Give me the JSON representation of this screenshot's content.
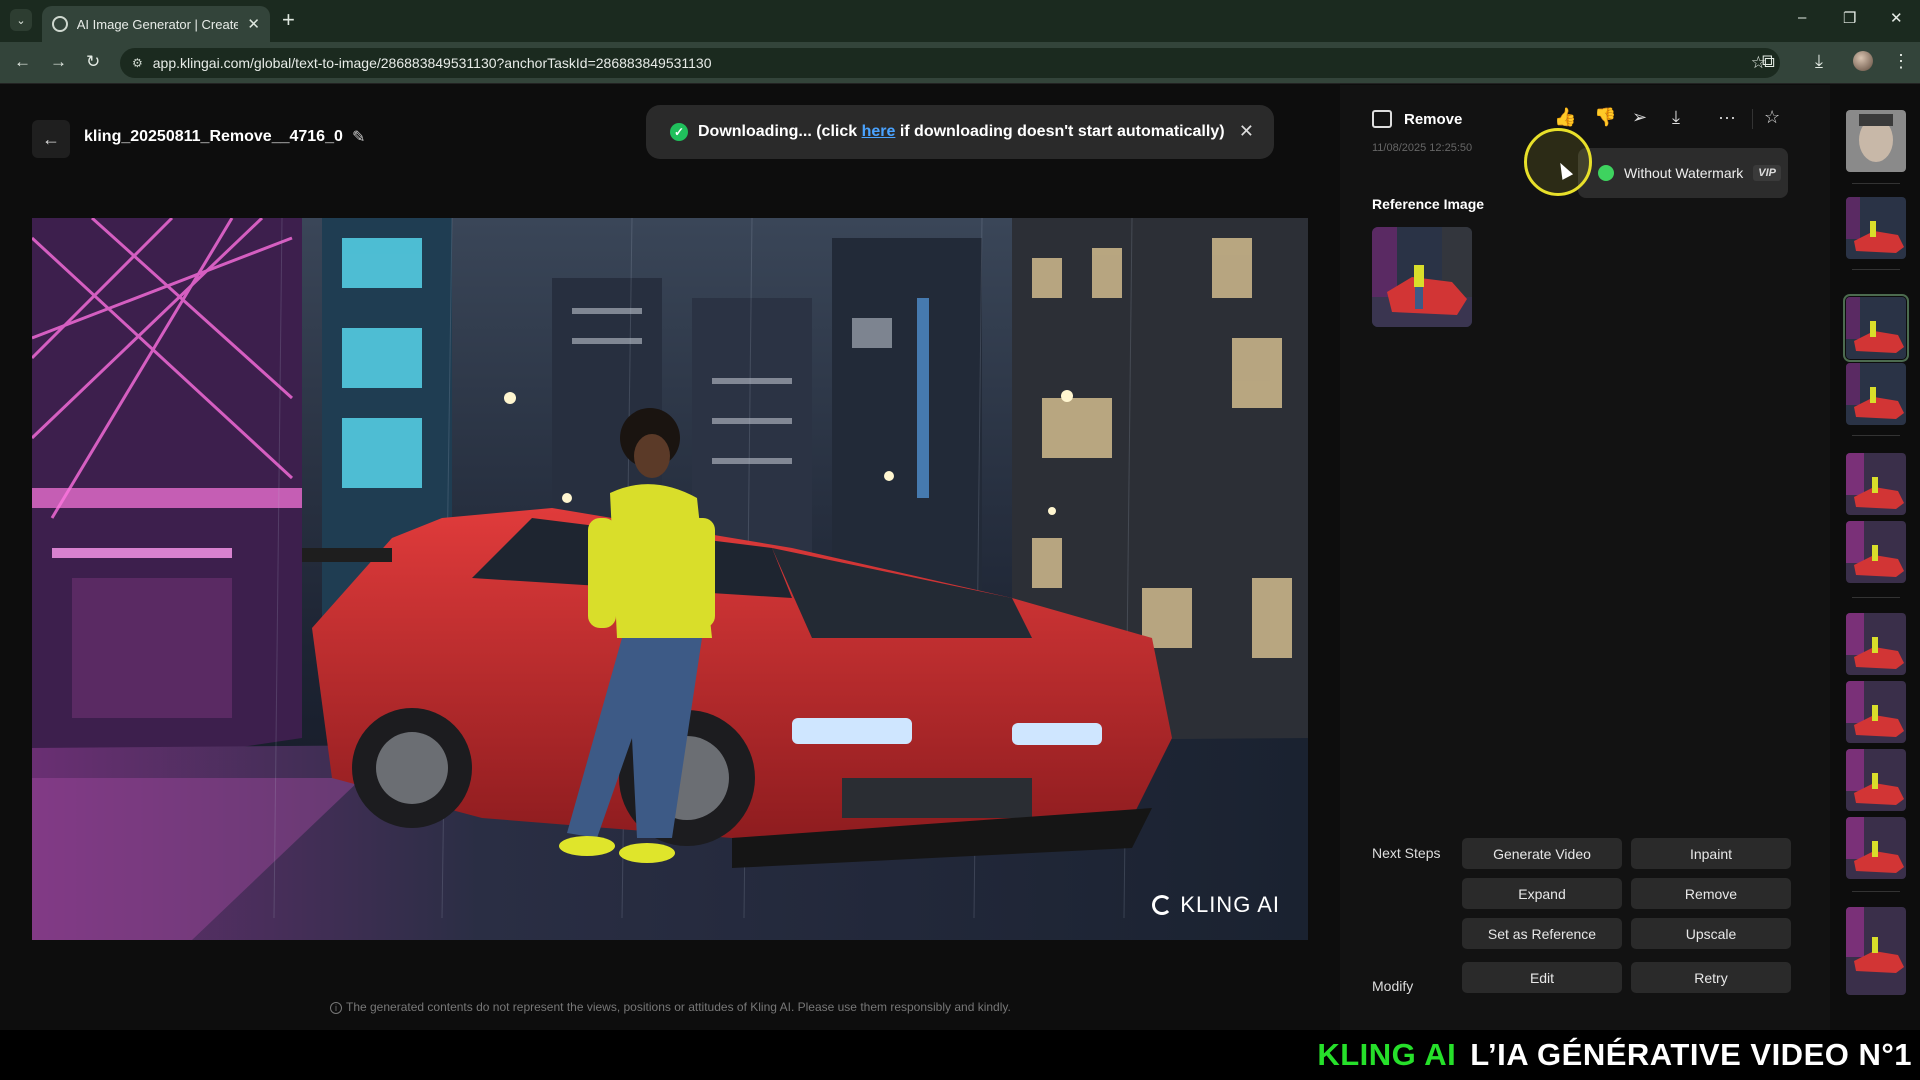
{
  "browser": {
    "tab_title": "AI Image Generator | Create HD",
    "url": "app.klingai.com/global/text-to-image/286883849531130?anchorTaskId=286883849531130",
    "icons": {
      "tab_list": "chevron-down-icon",
      "tab_close": "close-icon",
      "new_tab": "plus-icon",
      "back": "arrow-left-icon",
      "forward": "arrow-right-icon",
      "reload": "reload-icon",
      "bookmark": "star-icon",
      "extensions": "puzzle-icon",
      "download": "download-icon",
      "menu": "kebab-icon"
    },
    "glyphs": {
      "tab_list": "⌄",
      "tab_close": "✕",
      "new_tab": "+",
      "back": "←",
      "forward": "→",
      "reload": "↻",
      "site_info": "⚙",
      "bookmark": "☆",
      "extensions": "⧉",
      "download": "⤓",
      "menu": "⋮",
      "minimize": "–",
      "restore": "❐",
      "close": "✕"
    }
  },
  "header": {
    "title": "kling_20250811_Remove__4716_0",
    "back_glyph": "←",
    "edit_glyph": "✎"
  },
  "toast": {
    "check_glyph": "✓",
    "prefix": "Downloading... (click ",
    "link": "here",
    "suffix": " if downloading doesn't start automatically)",
    "close_glyph": "✕"
  },
  "image": {
    "watermark": "KLING AI"
  },
  "disclaimer": {
    "info_glyph": "i",
    "text": "The generated contents do not represent the views, positions or attitudes of Kling AI. Please use them responsibly and kindly."
  },
  "panel": {
    "title": "Remove",
    "date": "11/08/2025 12:25:50",
    "actions": {
      "like": "👍",
      "dislike": "👎",
      "share": "➢",
      "download": "⤓",
      "more": "···",
      "favorite": "☆"
    },
    "reference_label": "Reference Image",
    "watermark_option": {
      "label": "Without Watermark",
      "badge": "VIP"
    },
    "next_steps_label": "Next Steps",
    "modify_label": "Modify",
    "buttons": {
      "generate_video": "Generate Video",
      "inpaint": "Inpaint",
      "expand": "Expand",
      "remove": "Remove",
      "set_as_reference": "Set as Reference",
      "upscale": "Upscale",
      "edit": "Edit",
      "retry": "Retry"
    }
  },
  "banner": {
    "brand": "KLING AI",
    "text": "L’IA GÉNÉRATIVE VIDEO N°1"
  },
  "colors": {
    "accent_green": "#26e02a",
    "toast_check": "#20c05c",
    "watermark_toggle": "#3ed35f",
    "link": "#4aa3ff",
    "cursor_highlight": "#e8e02a"
  }
}
